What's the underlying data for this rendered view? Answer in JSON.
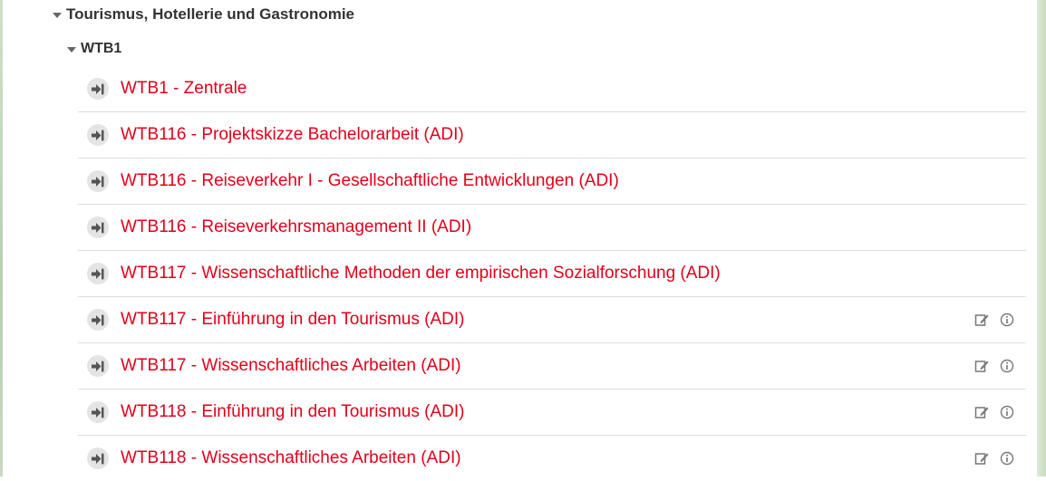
{
  "category": {
    "title": "Tourismus, Hotellerie und Gastronomie"
  },
  "subcategory": {
    "title": "WTB1"
  },
  "courses": [
    {
      "label": "WTB1 - Zentrale",
      "has_actions": false
    },
    {
      "label": "WTB116 - Projektskizze Bachelorarbeit (ADI)",
      "has_actions": false
    },
    {
      "label": "WTB116 - Reiseverkehr I - Gesellschaftliche Entwicklungen (ADI)",
      "has_actions": false
    },
    {
      "label": "WTB116 - Reiseverkehrsmanagement II (ADI)",
      "has_actions": false
    },
    {
      "label": "WTB117 - Wissenschaftliche Methoden der empirischen Sozialforschung (ADI)",
      "has_actions": false
    },
    {
      "label": "WTB117 - Einführung in den Tourismus (ADI)",
      "has_actions": true
    },
    {
      "label": "WTB117 - Wissenschaftliches Arbeiten (ADI)",
      "has_actions": true
    },
    {
      "label": "WTB118 - Einführung in den Tourismus (ADI)",
      "has_actions": true
    },
    {
      "label": "WTB118 - Wissenschaftliches Arbeiten (ADI)",
      "has_actions": true
    }
  ],
  "icons": {
    "enter": "sign-in-icon",
    "edit": "edit-icon",
    "info": "info-icon",
    "expanded": "caret-down-icon"
  },
  "colors": {
    "link": "#e2001a",
    "heading": "#333333",
    "icon": "#555555",
    "divider": "#dddddd"
  }
}
